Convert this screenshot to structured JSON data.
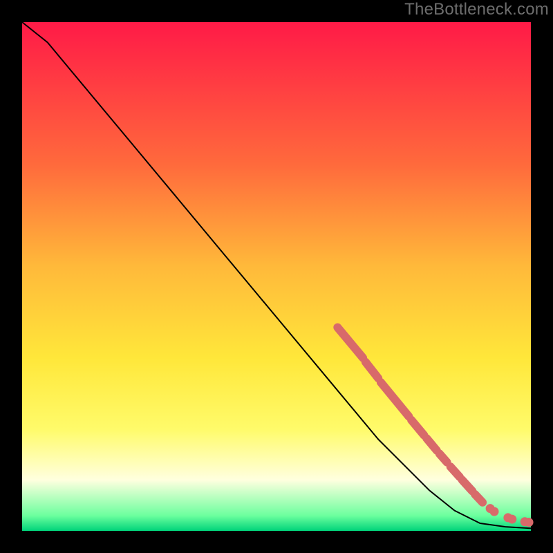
{
  "watermark": "TheBottleneck.com",
  "chart_data": {
    "type": "line",
    "title": "",
    "xlabel": "",
    "ylabel": "",
    "xlim": [
      0,
      100
    ],
    "ylim": [
      0,
      100
    ],
    "curve": [
      {
        "x": 0,
        "y": 100
      },
      {
        "x": 5,
        "y": 96
      },
      {
        "x": 10,
        "y": 90
      },
      {
        "x": 20,
        "y": 78
      },
      {
        "x": 30,
        "y": 66
      },
      {
        "x": 40,
        "y": 54
      },
      {
        "x": 50,
        "y": 42
      },
      {
        "x": 60,
        "y": 30
      },
      {
        "x": 70,
        "y": 18
      },
      {
        "x": 80,
        "y": 8
      },
      {
        "x": 85,
        "y": 4
      },
      {
        "x": 90,
        "y": 1.5
      },
      {
        "x": 95,
        "y": 0.8
      },
      {
        "x": 100,
        "y": 0.5
      }
    ],
    "marker_segments": [
      {
        "x1": 62,
        "y1": 40,
        "x2": 67,
        "y2": 34
      },
      {
        "x1": 67.5,
        "y1": 33.2,
        "x2": 70,
        "y2": 30
      },
      {
        "x1": 70.5,
        "y1": 29.2,
        "x2": 76,
        "y2": 22.5
      },
      {
        "x1": 76.5,
        "y1": 21.8,
        "x2": 79,
        "y2": 18.8
      },
      {
        "x1": 79.5,
        "y1": 18.2,
        "x2": 81.5,
        "y2": 15.8
      },
      {
        "x1": 82,
        "y1": 15.2,
        "x2": 83.5,
        "y2": 13.5
      },
      {
        "x1": 84.2,
        "y1": 12.6,
        "x2": 86,
        "y2": 10.6
      },
      {
        "x1": 86.5,
        "y1": 10,
        "x2": 88.5,
        "y2": 7.8
      },
      {
        "x1": 89,
        "y1": 7.2,
        "x2": 90.5,
        "y2": 5.6
      }
    ],
    "marker_dots": [
      {
        "x": 92,
        "y": 4.4
      },
      {
        "x": 92.8,
        "y": 3.8
      },
      {
        "x": 95.5,
        "y": 2.6
      },
      {
        "x": 96.3,
        "y": 2.3
      },
      {
        "x": 98.8,
        "y": 1.8
      },
      {
        "x": 99.6,
        "y": 1.7
      }
    ]
  }
}
